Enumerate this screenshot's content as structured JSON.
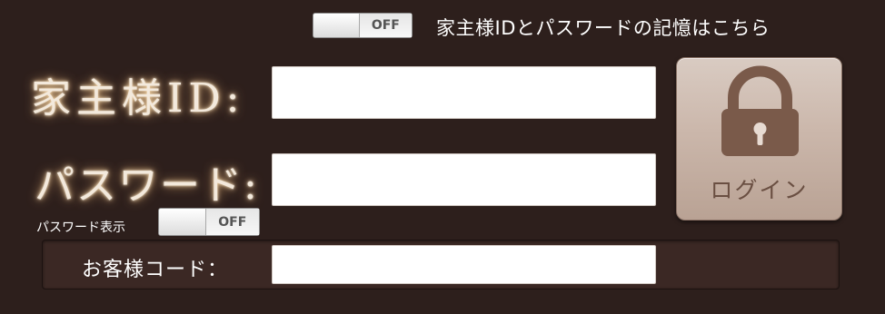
{
  "remember": {
    "toggle_state": "OFF",
    "label": "家主様IDとパスワードの記憶はこちら"
  },
  "fields": {
    "id_label": "家主様ID:",
    "id_value": "",
    "password_label": "パスワード:",
    "password_value": ""
  },
  "show_password": {
    "label": "パスワード表示",
    "toggle_state": "OFF"
  },
  "customer_code": {
    "label": "お客様コード：",
    "value": ""
  },
  "login": {
    "label": "ログイン",
    "icon": "lock-icon"
  },
  "colors": {
    "background": "#2d1f1c",
    "button": "#cbb7ab",
    "lock": "#7a5a4a",
    "label_glow": "#f5d7a8"
  }
}
